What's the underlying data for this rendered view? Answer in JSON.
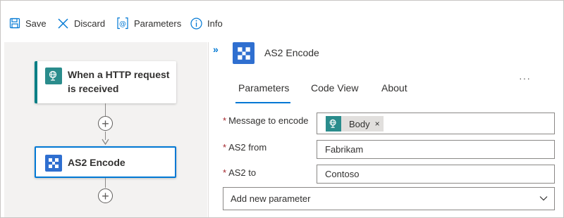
{
  "toolbar": {
    "save_label": "Save",
    "discard_label": "Discard",
    "parameters_label": "Parameters",
    "info_label": "Info"
  },
  "designer": {
    "trigger": {
      "title_line1": "When a HTTP request",
      "title_line2": "is received",
      "icon": "http-request-icon"
    },
    "action": {
      "title": "AS2 Encode",
      "icon": "as2-encode-icon"
    },
    "add_step_icon": "plus-circle-icon"
  },
  "panel": {
    "title": "AS2 Encode",
    "collapse_glyph": "»",
    "more_glyph": "···",
    "tabs": [
      {
        "label": "Parameters",
        "selected": true
      },
      {
        "label": "Code View",
        "selected": false
      },
      {
        "label": "About",
        "selected": false
      }
    ],
    "fields": {
      "message": {
        "label": "Message to encode",
        "required_mark": "*",
        "token_label": "Body",
        "token_remove": "×"
      },
      "as2_from": {
        "label": "AS2 from",
        "required_mark": "*",
        "value": "Fabrikam"
      },
      "as2_to": {
        "label": "AS2 to",
        "required_mark": "*",
        "value": "Contoso"
      }
    },
    "add_parameter": {
      "label": "Add new parameter"
    }
  },
  "colors": {
    "accent": "#0078d4",
    "trigger_accent": "#007f85",
    "as2_icon_bg": "#2f6fd0",
    "required": "#a4262c",
    "canvas_bg": "#f3f2f1"
  }
}
